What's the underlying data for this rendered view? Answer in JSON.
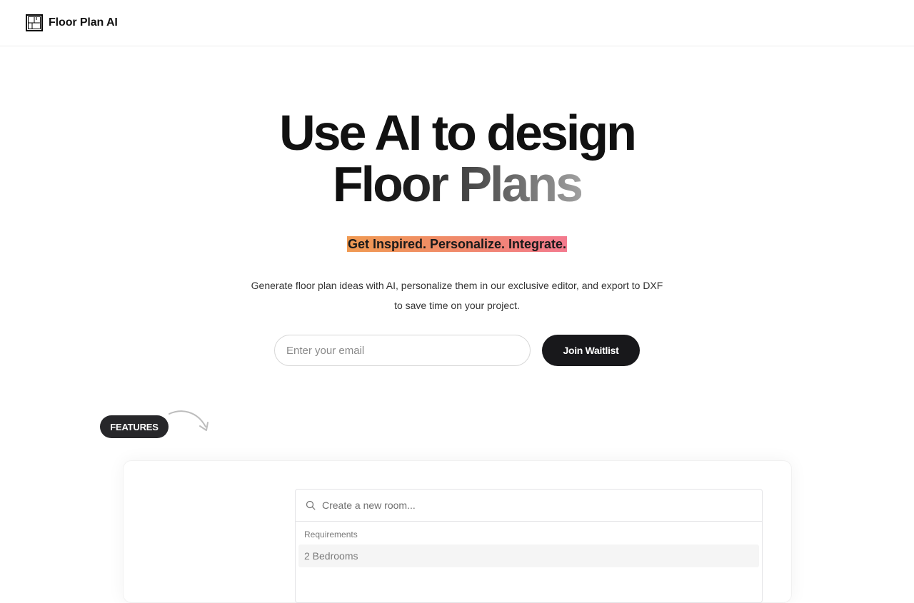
{
  "header": {
    "brand": "Floor Plan AI",
    "logo_icon": "floor-plan-icon"
  },
  "hero": {
    "title_line1": "Use AI to design",
    "title_line2": "Floor Plans",
    "tagline": "Get Inspired. Personalize. Integrate.",
    "description_line1": "Generate floor plan ideas with AI, personalize them in our exclusive editor, and export to DXF",
    "description_line2": "to save time on your project."
  },
  "waitlist": {
    "email_placeholder": "Enter your email",
    "button_label": "Join Waitlist"
  },
  "features": {
    "pill_label": "FEATURES"
  },
  "command": {
    "search_placeholder": "Create a new room...",
    "group_label": "Requirements",
    "items": [
      {
        "label": "2 Bedrooms"
      }
    ]
  },
  "colors": {
    "primary_button": "#18181b",
    "tagline_gradient_start": "#f09a52",
    "tagline_gradient_end": "#f37a8e"
  }
}
